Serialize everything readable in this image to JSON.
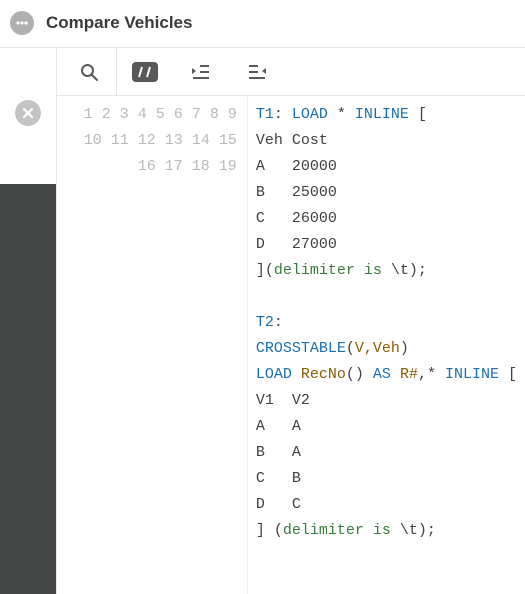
{
  "header": {
    "title": "Compare Vehicles"
  },
  "code": {
    "lines": [
      {
        "n": 1,
        "segs": [
          {
            "t": "T1",
            "c": "kw"
          },
          {
            "t": ": ",
            "c": ""
          },
          {
            "t": "LOAD",
            "c": "kw"
          },
          {
            "t": " * ",
            "c": ""
          },
          {
            "t": "INLINE",
            "c": "kw"
          },
          {
            "t": " [",
            "c": ""
          }
        ]
      },
      {
        "n": 2,
        "segs": [
          {
            "t": "Veh Cost",
            "c": ""
          }
        ]
      },
      {
        "n": 3,
        "segs": [
          {
            "t": "A   20000",
            "c": ""
          }
        ]
      },
      {
        "n": 4,
        "segs": [
          {
            "t": "B   25000",
            "c": ""
          }
        ]
      },
      {
        "n": 5,
        "segs": [
          {
            "t": "C   26000",
            "c": ""
          }
        ]
      },
      {
        "n": 6,
        "segs": [
          {
            "t": "D   27000",
            "c": ""
          }
        ]
      },
      {
        "n": 7,
        "segs": [
          {
            "t": "](",
            "c": ""
          },
          {
            "t": "delimiter is",
            "c": "arg"
          },
          {
            "t": " \\t);",
            "c": ""
          }
        ]
      },
      {
        "n": 8,
        "segs": [
          {
            "t": "",
            "c": ""
          }
        ]
      },
      {
        "n": 9,
        "segs": [
          {
            "t": "T2",
            "c": "kw"
          },
          {
            "t": ":",
            "c": ""
          }
        ]
      },
      {
        "n": 10,
        "segs": [
          {
            "t": "CROSSTABLE",
            "c": "kw"
          },
          {
            "t": "(",
            "c": "paren"
          },
          {
            "t": "V,Veh",
            "c": "fn"
          },
          {
            "t": ")",
            "c": "paren"
          }
        ]
      },
      {
        "n": 11,
        "segs": [
          {
            "t": "LOAD",
            "c": "kw"
          },
          {
            "t": " ",
            "c": ""
          },
          {
            "t": "RecNo",
            "c": "fn"
          },
          {
            "t": "()",
            "c": "paren"
          },
          {
            "t": " ",
            "c": ""
          },
          {
            "t": "AS",
            "c": "kw"
          },
          {
            "t": " ",
            "c": ""
          },
          {
            "t": "R#",
            "c": "fn"
          },
          {
            "t": ",* ",
            "c": ""
          },
          {
            "t": "INLINE",
            "c": "kw"
          },
          {
            "t": " [",
            "c": ""
          }
        ]
      },
      {
        "n": 12,
        "segs": [
          {
            "t": "V1  V2",
            "c": ""
          }
        ]
      },
      {
        "n": 13,
        "segs": [
          {
            "t": "A   A",
            "c": ""
          }
        ]
      },
      {
        "n": 14,
        "segs": [
          {
            "t": "B   A",
            "c": ""
          }
        ]
      },
      {
        "n": 15,
        "segs": [
          {
            "t": "C   B",
            "c": ""
          }
        ]
      },
      {
        "n": 16,
        "segs": [
          {
            "t": "D   C",
            "c": ""
          }
        ]
      },
      {
        "n": 17,
        "segs": [
          {
            "t": "] (",
            "c": ""
          },
          {
            "t": "delimiter is",
            "c": "arg"
          },
          {
            "t": " \\t);",
            "c": ""
          }
        ]
      },
      {
        "n": 18,
        "segs": [
          {
            "t": "",
            "c": ""
          }
        ]
      },
      {
        "n": 19,
        "segs": [
          {
            "t": "",
            "c": ""
          }
        ]
      }
    ]
  }
}
